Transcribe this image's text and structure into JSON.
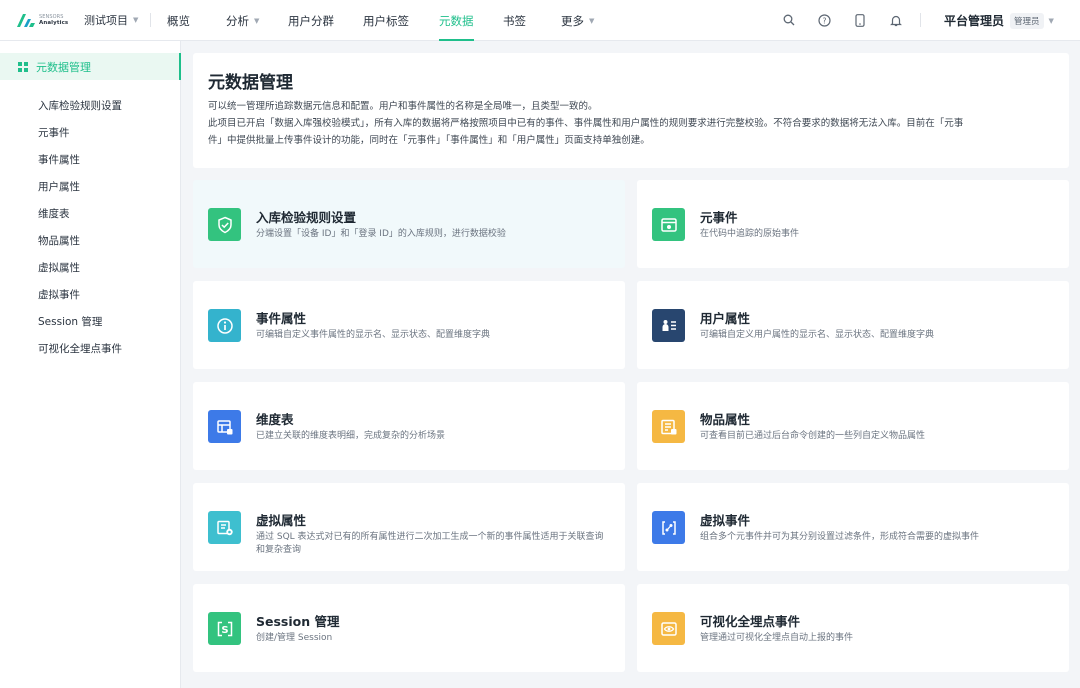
{
  "brand": {
    "line1": "SENSORS",
    "line2": "Analytics"
  },
  "project": {
    "name": "测试项目"
  },
  "nav": {
    "items": [
      {
        "label": "概览",
        "has_caret": false
      },
      {
        "label": "分析",
        "has_caret": true
      },
      {
        "label": "用户分群",
        "has_caret": false
      },
      {
        "label": "用户标签",
        "has_caret": false
      },
      {
        "label": "元数据",
        "has_caret": false,
        "active": true
      },
      {
        "label": "书签",
        "has_caret": false
      },
      {
        "label": "更多",
        "has_caret": true
      }
    ]
  },
  "toolbar_icons": [
    "search-icon",
    "help-icon",
    "mobile-icon",
    "bell-icon"
  ],
  "user": {
    "name": "平台管理员",
    "role": "管理员"
  },
  "sidebar": {
    "title": "元数据管理",
    "items": [
      {
        "label": "入库检验规则设置"
      },
      {
        "label": "元事件"
      },
      {
        "label": "事件属性"
      },
      {
        "label": "用户属性"
      },
      {
        "label": "维度表"
      },
      {
        "label": "物品属性"
      },
      {
        "label": "虚拟属性"
      },
      {
        "label": "虚拟事件"
      },
      {
        "label": "Session 管理"
      },
      {
        "label": "可视化全埋点事件"
      }
    ]
  },
  "intro": {
    "title": "元数据管理",
    "lines": [
      "可以统一管理所追踪数据元信息和配置。用户和事件属性的名称是全局唯一，且类型一致的。",
      "此项目已开启「数据入库强校验模式」，所有入库的数据将严格按照项目中已有的事件、事件属性和用户属性的规则要求进行完整校验。不符合要求的数据将无法入库。目前在「元事",
      "件」中提供批量上传事件设计的功能，同时在「元事件」「事件属性」和「用户属性」页面支持单独创建。"
    ]
  },
  "cards": [
    {
      "title": "入库检验规则设置",
      "desc": "分端设置「设备 ID」和「登录 ID」的入库规则，进行数据校验",
      "icon": "shield-check-icon",
      "color": "#33c37f"
    },
    {
      "title": "元事件",
      "desc": "在代码中追踪的原始事件",
      "icon": "event-window-icon",
      "color": "#33c37f"
    },
    {
      "title": "事件属性",
      "desc": "可编辑自定义事件属性的显示名、显示状态、配置维度字典",
      "icon": "info-circle-icon",
      "color": "#34b3cd"
    },
    {
      "title": "用户属性",
      "desc": "可编辑自定义用户属性的显示名、显示状态、配置维度字典",
      "icon": "user-list-icon",
      "color": "#28466f"
    },
    {
      "title": "维度表",
      "desc": "已建立关联的维度表明细，完成复杂的分析场景",
      "icon": "table-link-icon",
      "color": "#3d7ae8"
    },
    {
      "title": "物品属性",
      "desc": "可查看目前已通过后台命令创建的一些列自定义物品属性",
      "icon": "item-list-icon",
      "color": "#f5b843"
    },
    {
      "title": "虚拟属性",
      "desc": "通过 SQL 表达式对已有的所有属性进行二次加工生成一个新的事件属性适用于关联查询和复杂查询",
      "icon": "virtual-property-icon",
      "color": "#3ebfcf"
    },
    {
      "title": "虚拟事件",
      "desc": "组合多个元事件并可为其分别设置过滤条件，形成符合需要的虚拟事件",
      "icon": "virtual-event-icon",
      "color": "#3d7ae8"
    },
    {
      "title": "Session 管理",
      "desc": "创建/管理 Session",
      "icon": "session-icon",
      "color": "#33c37f"
    },
    {
      "title": "可视化全埋点事件",
      "desc": "管理通过可视化全埋点自动上报的事件",
      "icon": "eye-icon",
      "color": "#f5b843"
    }
  ]
}
